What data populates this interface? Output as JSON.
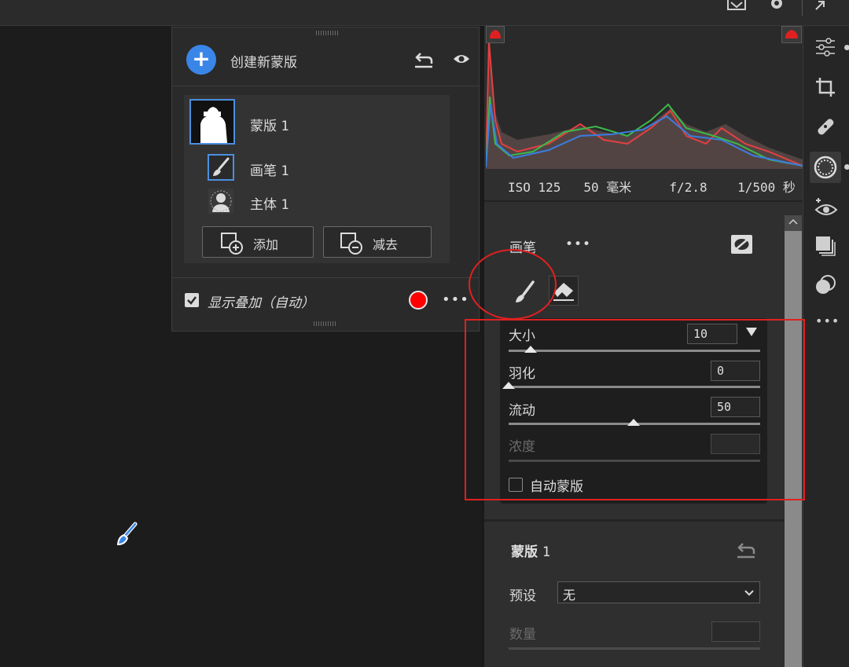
{
  "mask_panel": {
    "create_label": "创建新蒙版",
    "mask_item": {
      "label": "蒙版",
      "index": "1"
    },
    "components": [
      {
        "label": "画笔",
        "index": "1",
        "icon": "brush-icon"
      },
      {
        "label": "主体",
        "index": "1",
        "icon": "subject-icon"
      }
    ],
    "add_label": "添加",
    "subtract_label": "减去",
    "overlay_label": "显示叠加（自动）",
    "overlay_checked": true,
    "overlay_color": "#ff0000"
  },
  "histogram": {
    "iso": "ISO 125",
    "focal": "50 毫米",
    "aperture": "f/2.8",
    "shutter": "1/500 秒"
  },
  "brush_panel": {
    "title": "画笔",
    "more": "•••",
    "sliders": [
      {
        "label": "大小",
        "value": "10",
        "level": 0.07,
        "has_dropdown": true
      },
      {
        "label": "羽化",
        "value": "0",
        "level": 0.0
      },
      {
        "label": "流动",
        "value": "50",
        "level": 0.5
      },
      {
        "label": "浓度",
        "value": "",
        "level": null,
        "disabled": true
      }
    ],
    "auto_mask_label": "自动蒙版",
    "auto_mask_checked": false
  },
  "mask_settings": {
    "title": "蒙版",
    "index": "1",
    "preset_label": "预设",
    "preset_value": "无",
    "amount_label": "数量",
    "amount_value": ""
  },
  "colors": {
    "accent": "#3a86e8",
    "annotation": "#e02020"
  }
}
